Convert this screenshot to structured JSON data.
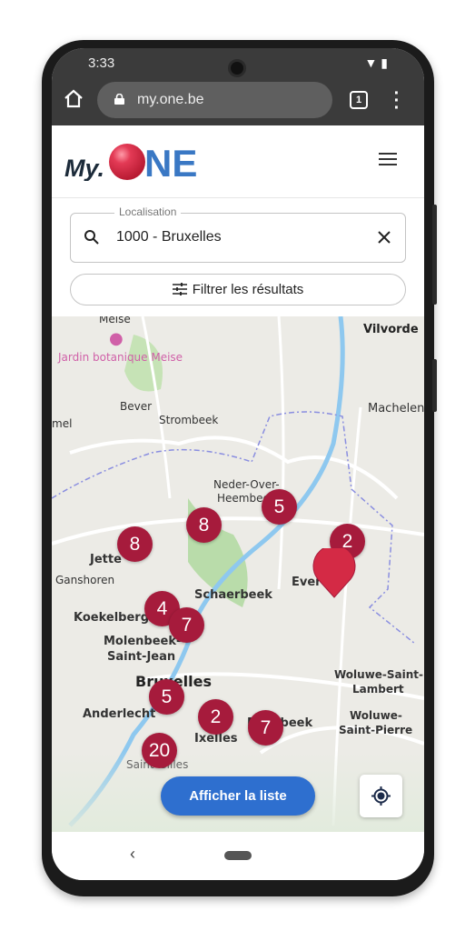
{
  "status_bar": {
    "time": "3:33"
  },
  "browser": {
    "url": "my.one.be",
    "tab_count": "1"
  },
  "header": {
    "logo_text": "My.ONE",
    "logo_colors": {
      "my": "#1c2b3a",
      "ball": "#d42a45",
      "ne": "#3a78c4"
    }
  },
  "search": {
    "label": "Localisation",
    "value": "1000 - Bruxelles"
  },
  "filter": {
    "label": "Filtrer les résultats"
  },
  "map": {
    "labels": [
      "Meise",
      "Jardin botanique Meise",
      "Vilvorde",
      "Bever",
      "Strombeek",
      "Machelen",
      "mel",
      "Neder-Over-",
      "Heembeek",
      "Jette",
      "Ganshoren",
      "Evere",
      "Schaerbeek",
      "Koekelberg",
      "Molenbeek-",
      "Saint-Jean",
      "Bruxelles",
      "Anderlecht",
      "Woluwe-Saint-",
      "Lambert",
      "Woluwe-",
      "Saint-Pierre",
      "Etterbeek",
      "Ixelles",
      "Saint-Gilles"
    ],
    "clusters": [
      "5",
      "8",
      "8",
      "2",
      "4",
      "7",
      "5",
      "2",
      "7",
      "20"
    ],
    "cluster_color": "#a61b3c"
  },
  "actions": {
    "show_list": "Afficher la liste"
  }
}
